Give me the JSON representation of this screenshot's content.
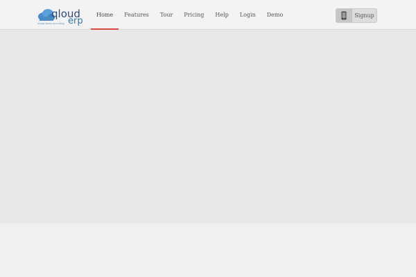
{
  "brand": {
    "name": "qloud",
    "suffix": "erp",
    "tagline": "Simple Online Accounting",
    "icon": "cloud-icon"
  },
  "nav": {
    "items": [
      {
        "label": "Home",
        "active": true
      },
      {
        "label": "Features",
        "active": false
      },
      {
        "label": "Tour",
        "active": false
      },
      {
        "label": "Pricing",
        "active": false
      },
      {
        "label": "Help",
        "active": false
      },
      {
        "label": "Login",
        "active": false
      },
      {
        "label": "Demo",
        "active": false
      }
    ]
  },
  "signup": {
    "label": "Signup",
    "icon": "mobile-phone-icon"
  },
  "colors": {
    "accent": "#d84a3c",
    "brand": "#2c4a7a"
  }
}
